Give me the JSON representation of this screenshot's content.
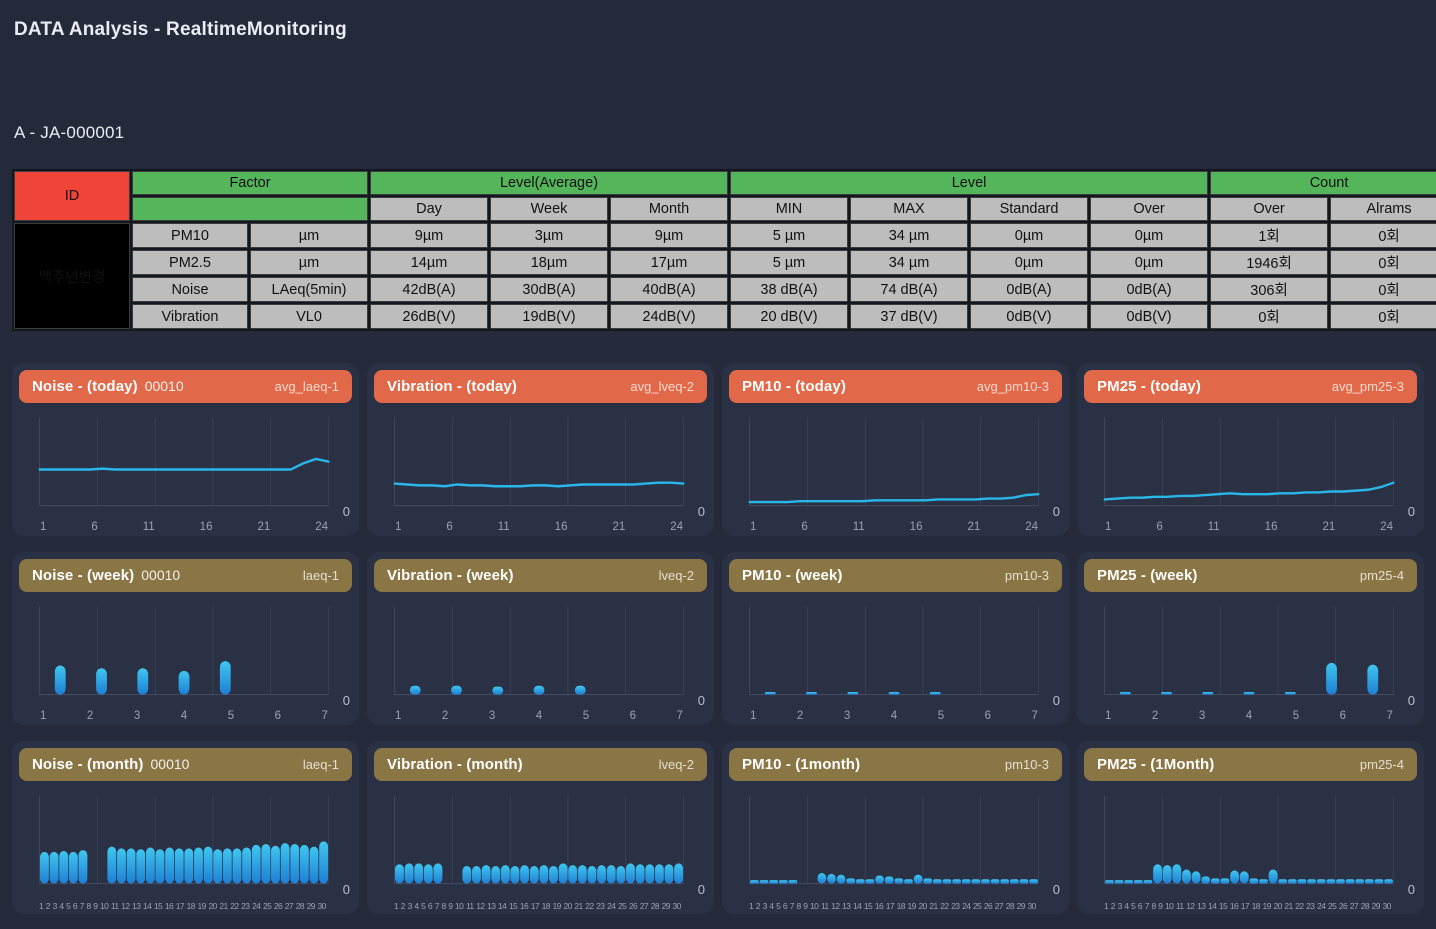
{
  "header": {
    "title": "DATA Analysis - RealtimeMonitoring",
    "station": "A - JA-000001"
  },
  "table": {
    "id_header": "ID",
    "factor_header": "Factor",
    "group_level_average": "Level(Average)",
    "group_level": "Level",
    "group_count": "Count",
    "sub_headers": [
      "Day",
      "Week",
      "Month",
      "MIN",
      "MAX",
      "Standard",
      "Over",
      "Over",
      "Alrams"
    ],
    "id_value": "백주년변경",
    "rows": [
      {
        "factor": "PM10",
        "unit": "µm",
        "day": "9µm",
        "week": "3µm",
        "month": "9µm",
        "min": "5 µm",
        "max": "34 µm",
        "standard": "0µm",
        "over": "0µm",
        "count_over": "1회",
        "alarms": "0회"
      },
      {
        "factor": "PM2.5",
        "unit": "µm",
        "day": "14µm",
        "week": "18µm",
        "month": "17µm",
        "min": "5 µm",
        "max": "34 µm",
        "standard": "0µm",
        "over": "0µm",
        "count_over": "1946회",
        "alarms": "0회"
      },
      {
        "factor": "Noise",
        "unit": "LAeq(5min)",
        "day": "42dB(A)",
        "week": "30dB(A)",
        "month": "40dB(A)",
        "min": "38 dB(A)",
        "max": "74 dB(A)",
        "standard": "0dB(A)",
        "over": "0dB(A)",
        "count_over": "306회",
        "alarms": "0회"
      },
      {
        "factor": "Vibration",
        "unit": "VL0",
        "day": "26dB(V)",
        "week": "19dB(V)",
        "month": "24dB(V)",
        "min": "20 dB(V)",
        "max": "37 dB(V)",
        "standard": "0dB(V)",
        "over": "0dB(V)",
        "count_over": "0회",
        "alarms": "0회"
      }
    ]
  },
  "colors": {
    "accent_red": "#f04438",
    "accent_green": "#54b55b",
    "today_header": "#e1694a",
    "period_header": "#8a7544",
    "series_blue": "#29b6e8",
    "background": "#242a3a",
    "card_background": "#2b3145"
  },
  "cards": [
    {
      "name": "noise-today",
      "title": "Noise - (today)",
      "sub": "00010",
      "tag": "avg_laeq-1",
      "header_style": "today",
      "zero": "0",
      "chart_data": {
        "type": "line",
        "title": "Noise - (today)",
        "xlabel": "",
        "ylabel": "",
        "tick_labels": [
          "1",
          "6",
          "11",
          "16",
          "21",
          "24"
        ],
        "x": [
          1,
          2,
          3,
          4,
          5,
          6,
          7,
          8,
          9,
          10,
          11,
          12,
          13,
          14,
          15,
          16,
          17,
          18,
          19,
          20,
          21,
          22,
          23,
          24
        ],
        "values": [
          41,
          41,
          41,
          41,
          41,
          42,
          41,
          41,
          41,
          41,
          41,
          41,
          41,
          41,
          41,
          41,
          41,
          41,
          41,
          41,
          41,
          48,
          53,
          50
        ],
        "ylim": [
          0,
          100
        ],
        "grid": true
      }
    },
    {
      "name": "vibration-today",
      "title": "Vibration - (today)",
      "sub": "",
      "tag": "avg_lveq-2",
      "header_style": "today",
      "zero": "0",
      "chart_data": {
        "type": "line",
        "title": "Vibration - (today)",
        "xlabel": "",
        "ylabel": "",
        "tick_labels": [
          "1",
          "6",
          "11",
          "16",
          "21",
          "24"
        ],
        "x": [
          1,
          2,
          3,
          4,
          5,
          6,
          7,
          8,
          9,
          10,
          11,
          12,
          13,
          14,
          15,
          16,
          17,
          18,
          19,
          20,
          21,
          22,
          23,
          24
        ],
        "values": [
          25,
          24,
          23,
          23,
          22,
          24,
          23,
          23,
          22,
          22,
          22,
          23,
          23,
          22,
          23,
          24,
          24,
          24,
          24,
          24,
          25,
          26,
          26,
          25
        ],
        "ylim": [
          0,
          100
        ],
        "grid": true
      }
    },
    {
      "name": "pm10-today",
      "title": "PM10 - (today)",
      "sub": "",
      "tag": "avg_pm10-3",
      "header_style": "today",
      "zero": "0",
      "chart_data": {
        "type": "line",
        "title": "PM10 - (today)",
        "xlabel": "",
        "ylabel": "",
        "tick_labels": [
          "1",
          "6",
          "11",
          "16",
          "21",
          "24"
        ],
        "x": [
          1,
          2,
          3,
          4,
          5,
          6,
          7,
          8,
          9,
          10,
          11,
          12,
          13,
          14,
          15,
          16,
          17,
          18,
          19,
          20,
          21,
          22,
          23,
          24
        ],
        "values": [
          4,
          4,
          4,
          4,
          5,
          5,
          5,
          5,
          5,
          5,
          6,
          6,
          6,
          6,
          6,
          7,
          7,
          7,
          7,
          8,
          8,
          9,
          12,
          13
        ],
        "ylim": [
          0,
          100
        ],
        "grid": true
      }
    },
    {
      "name": "pm25-today",
      "title": "PM25 - (today)",
      "sub": "",
      "tag": "avg_pm25-3",
      "header_style": "today",
      "zero": "0",
      "chart_data": {
        "type": "line",
        "title": "PM25 - (today)",
        "xlabel": "",
        "ylabel": "",
        "tick_labels": [
          "1",
          "6",
          "11",
          "16",
          "21",
          "24"
        ],
        "x": [
          1,
          2,
          3,
          4,
          5,
          6,
          7,
          8,
          9,
          10,
          11,
          12,
          13,
          14,
          15,
          16,
          17,
          18,
          19,
          20,
          21,
          22,
          23,
          24
        ],
        "values": [
          7,
          8,
          9,
          9,
          10,
          10,
          11,
          11,
          12,
          13,
          14,
          13,
          13,
          13,
          14,
          14,
          15,
          15,
          16,
          16,
          17,
          18,
          21,
          26
        ],
        "ylim": [
          0,
          100
        ],
        "grid": true
      }
    },
    {
      "name": "noise-week",
      "title": "Noise - (week)",
      "sub": "00010",
      "tag": "laeq-1",
      "header_style": "period",
      "zero": "0",
      "chart_data": {
        "type": "bar",
        "title": "Noise - (week)",
        "xlabel": "",
        "ylabel": "",
        "categories": [
          "1",
          "2",
          "3",
          "4",
          "5",
          "6",
          "7"
        ],
        "values": [
          33,
          30,
          30,
          27,
          38,
          0,
          0
        ],
        "ylim": [
          0,
          100
        ],
        "grid": true
      }
    },
    {
      "name": "vibration-week",
      "title": "Vibration - (week)",
      "sub": "",
      "tag": "lveq-2",
      "header_style": "period",
      "zero": "0",
      "chart_data": {
        "type": "bar",
        "title": "Vibration - (week)",
        "xlabel": "",
        "ylabel": "",
        "categories": [
          "1",
          "2",
          "3",
          "4",
          "5",
          "6",
          "7"
        ],
        "values": [
          10,
          10,
          9,
          10,
          10,
          0,
          0
        ],
        "ylim": [
          0,
          100
        ],
        "grid": true
      }
    },
    {
      "name": "pm10-week",
      "title": "PM10 - (week)",
      "sub": "",
      "tag": "pm10-3",
      "header_style": "period",
      "zero": "0",
      "chart_data": {
        "type": "bar",
        "title": "PM10 - (week)",
        "xlabel": "",
        "ylabel": "",
        "categories": [
          "1",
          "2",
          "3",
          "4",
          "5",
          "6",
          "7"
        ],
        "values": [
          3,
          3,
          3,
          3,
          3,
          0,
          0
        ],
        "ylim": [
          0,
          100
        ],
        "grid": true
      }
    },
    {
      "name": "pm25-week",
      "title": "PM25 - (week)",
      "sub": "",
      "tag": "pm25-4",
      "header_style": "period",
      "zero": "0",
      "chart_data": {
        "type": "bar",
        "title": "PM25 - (week)",
        "xlabel": "",
        "ylabel": "",
        "categories": [
          "1",
          "2",
          "3",
          "4",
          "5",
          "6",
          "7"
        ],
        "values": [
          3,
          3,
          3,
          3,
          3,
          36,
          34
        ],
        "ylim": [
          0,
          100
        ],
        "grid": true
      }
    },
    {
      "name": "noise-month",
      "title": "Noise - (month)",
      "sub": "00010",
      "tag": "laeq-1",
      "header_style": "period",
      "zero": "0",
      "chart_data": {
        "type": "bar",
        "title": "Noise - (month)",
        "xlabel": "",
        "ylabel": "",
        "categories": [
          "1",
          "2",
          "3",
          "4",
          "5",
          "6",
          "7",
          "8",
          "9",
          "10",
          "11",
          "12",
          "13",
          "14",
          "15",
          "16",
          "17",
          "18",
          "19",
          "20",
          "21",
          "22",
          "23",
          "24",
          "25",
          "26",
          "27",
          "28",
          "29",
          "30"
        ],
        "values": [
          36,
          36,
          37,
          36,
          38,
          0,
          0,
          42,
          40,
          40,
          39,
          41,
          39,
          41,
          40,
          40,
          41,
          42,
          39,
          40,
          40,
          41,
          44,
          45,
          43,
          46,
          45,
          44,
          42,
          48
        ],
        "ylim": [
          0,
          100
        ],
        "grid": true
      }
    },
    {
      "name": "vibration-month",
      "title": "Vibration - (month)",
      "sub": "",
      "tag": "lveq-2",
      "header_style": "period",
      "zero": "0",
      "chart_data": {
        "type": "bar",
        "title": "Vibration - (month)",
        "xlabel": "",
        "ylabel": "",
        "categories": [
          "1",
          "2",
          "3",
          "4",
          "5",
          "6",
          "7",
          "8",
          "9",
          "10",
          "11",
          "12",
          "13",
          "14",
          "15",
          "16",
          "17",
          "18",
          "19",
          "20",
          "21",
          "22",
          "23",
          "24",
          "25",
          "26",
          "27",
          "28",
          "29",
          "30"
        ],
        "values": [
          22,
          23,
          23,
          22,
          23,
          0,
          0,
          20,
          20,
          21,
          20,
          21,
          20,
          21,
          20,
          21,
          20,
          23,
          21,
          21,
          20,
          21,
          21,
          20,
          23,
          22,
          22,
          22,
          22,
          23
        ],
        "ylim": [
          0,
          100
        ],
        "grid": true
      }
    },
    {
      "name": "pm10-1month",
      "title": "PM10 - (1month)",
      "sub": "",
      "tag": "pm10-3",
      "header_style": "period",
      "zero": "0",
      "chart_data": {
        "type": "bar",
        "title": "PM10 - (1month)",
        "xlabel": "",
        "ylabel": "",
        "categories": [
          "1",
          "2",
          "3",
          "4",
          "5",
          "6",
          "7",
          "8",
          "9",
          "10",
          "11",
          "12",
          "13",
          "14",
          "15",
          "16",
          "17",
          "18",
          "19",
          "20",
          "21",
          "22",
          "23",
          "24",
          "25",
          "26",
          "27",
          "28",
          "29",
          "30"
        ],
        "values": [
          4,
          4,
          4,
          4,
          4,
          0,
          0,
          12,
          11,
          10,
          6,
          5,
          5,
          9,
          8,
          6,
          5,
          10,
          6,
          5,
          5,
          5,
          5,
          5,
          5,
          5,
          5,
          5,
          5,
          5
        ],
        "ylim": [
          0,
          100
        ],
        "grid": true
      }
    },
    {
      "name": "pm25-1month",
      "title": "PM25 - (1Month)",
      "sub": "",
      "tag": "pm25-4",
      "header_style": "period",
      "zero": "0",
      "chart_data": {
        "type": "bar",
        "title": "PM25 - (1Month)",
        "xlabel": "",
        "ylabel": "",
        "categories": [
          "1",
          "2",
          "3",
          "4",
          "5",
          "6",
          "7",
          "8",
          "9",
          "10",
          "11",
          "12",
          "13",
          "14",
          "15",
          "16",
          "17",
          "18",
          "19",
          "20",
          "21",
          "22",
          "23",
          "24",
          "25",
          "26",
          "27",
          "28",
          "29",
          "30"
        ],
        "values": [
          4,
          4,
          4,
          4,
          4,
          22,
          21,
          22,
          16,
          14,
          8,
          6,
          6,
          15,
          14,
          6,
          5,
          16,
          5,
          5,
          5,
          5,
          5,
          5,
          5,
          5,
          5,
          5,
          5,
          5
        ],
        "ylim": [
          0,
          100
        ],
        "grid": true
      }
    }
  ]
}
